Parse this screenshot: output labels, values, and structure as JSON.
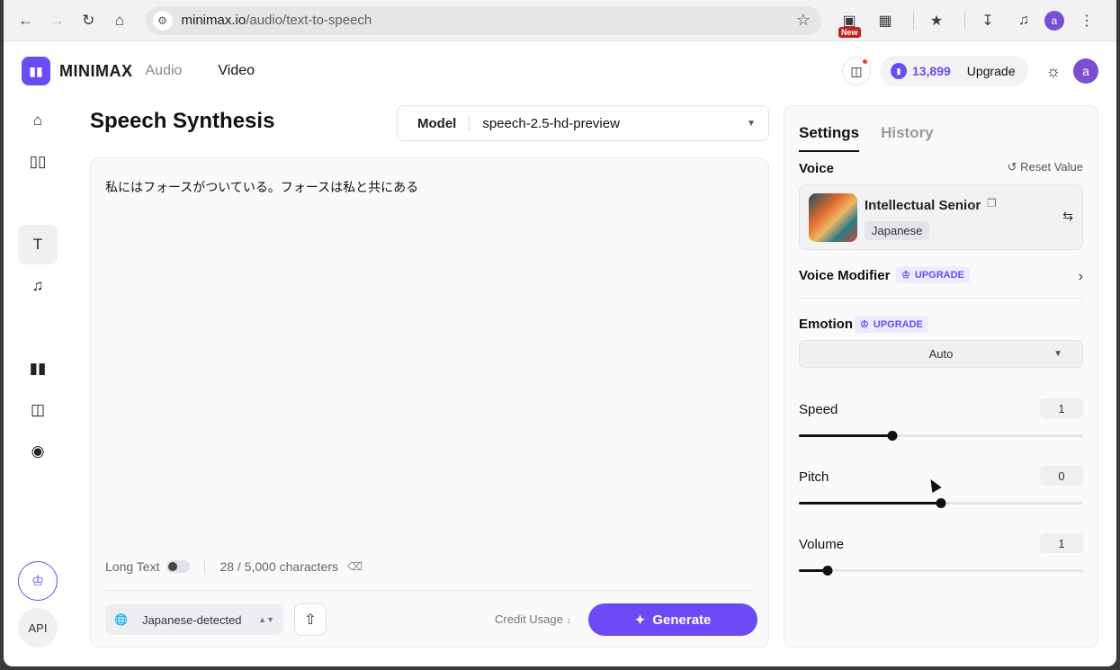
{
  "browser": {
    "url_host": "minimax.io",
    "url_path": "/audio/text-to-speech",
    "new_badge": "New",
    "profile_initial": "a"
  },
  "header": {
    "logo_text": "MINIMAX",
    "tab_audio": "Audio",
    "tab_video": "Video",
    "credits": "13,899",
    "upgrade": "Upgrade",
    "avatar_initial": "a"
  },
  "sidebar": {
    "api_label": "API"
  },
  "main": {
    "title": "Speech Synthesis",
    "model_label": "Model",
    "model_value": "speech-2.5-hd-preview",
    "input_text": "私にはフォースがついている。フォースは私と共にある",
    "long_text_label": "Long Text",
    "char_count": "28 / 5,000 characters",
    "language": "Japanese-detected",
    "credit_usage": "Credit Usage",
    "generate": "Generate"
  },
  "settings": {
    "tab_settings": "Settings",
    "tab_history": "History",
    "voice_label": "Voice",
    "reset_value": "Reset Value",
    "voice_name": "Intellectual Senior",
    "voice_language": "Japanese",
    "voice_modifier": "Voice Modifier",
    "upgrade_badge": "UPGRADE",
    "emotion_label": "Emotion",
    "emotion_value": "Auto",
    "speed_label": "Speed",
    "speed_value": "1",
    "speed_fraction": 0.33,
    "pitch_label": "Pitch",
    "pitch_value": "0",
    "pitch_fraction": 0.5,
    "volume_label": "Volume",
    "volume_value": "1",
    "volume_fraction": 0.1
  },
  "colors": {
    "accent": "#6a4bf5"
  }
}
